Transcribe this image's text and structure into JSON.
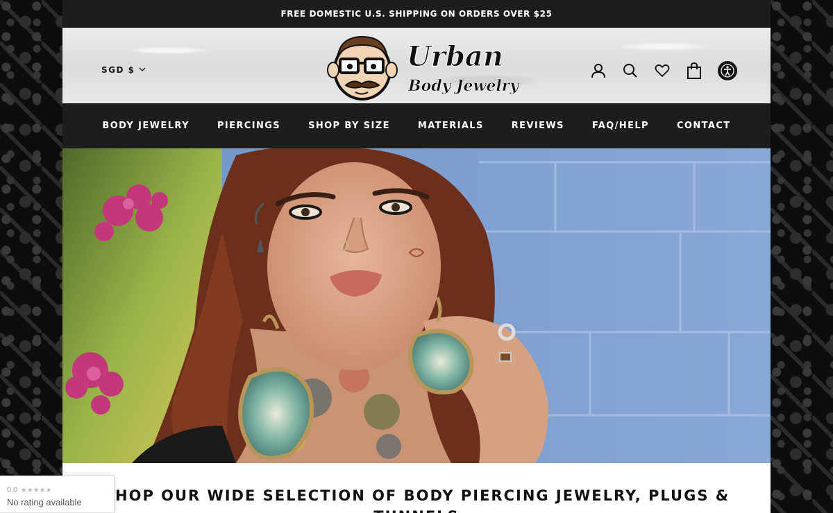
{
  "announcement": "FREE DOMESTIC U.S. SHIPPING ON ORDERS OVER $25",
  "header": {
    "currency": "SGD $",
    "logo": {
      "line1": "Urban",
      "line2": "Body Jewelry"
    },
    "icons": [
      "account-icon",
      "search-icon",
      "wishlist-heart-icon",
      "cart-bag-icon",
      "accessibility-icon"
    ]
  },
  "nav": {
    "items": [
      {
        "label": "BODY JEWELRY"
      },
      {
        "label": "PIERCINGS"
      },
      {
        "label": "SHOP BY SIZE"
      },
      {
        "label": "MATERIALS"
      },
      {
        "label": "REVIEWS"
      },
      {
        "label": "FAQ/HELP"
      },
      {
        "label": "CONTACT"
      }
    ]
  },
  "headline": "SHOP OUR WIDE SELECTION OF BODY PIERCING JEWELRY, PLUGS & TUNNELS",
  "rating_badge": {
    "score": "0.0",
    "stars": "★★★★★",
    "text": "No rating available"
  },
  "colors": {
    "dark_bar": "#1d1d1d",
    "white": "#ffffff",
    "wall_blue": "#7fa0cf"
  }
}
